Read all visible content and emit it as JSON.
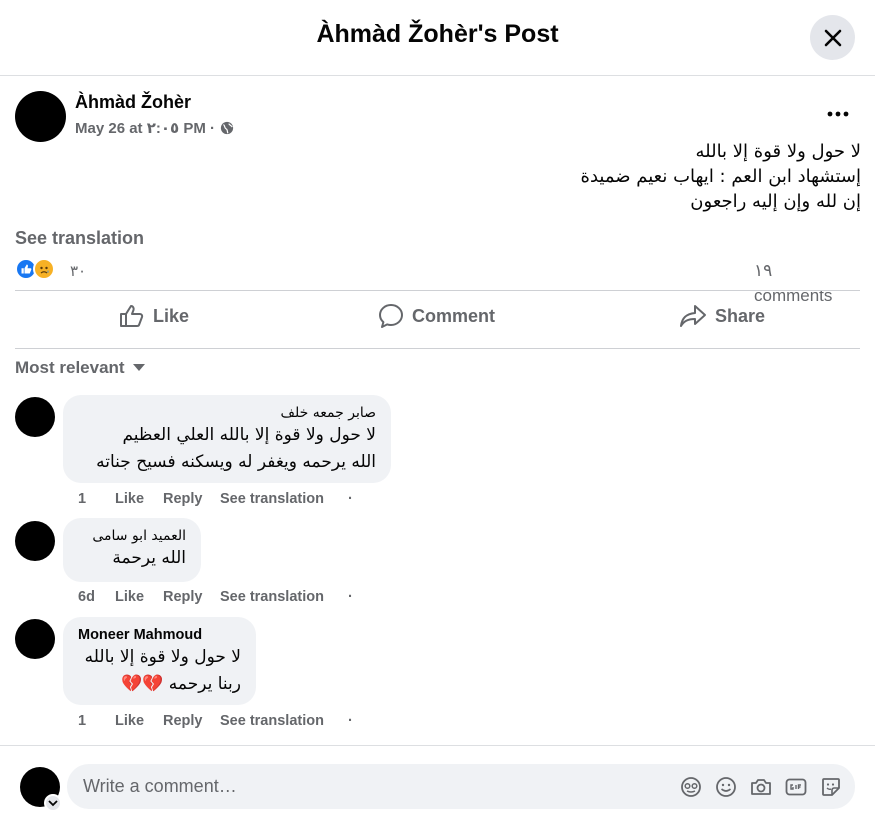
{
  "header": {
    "title": "Àhmàd Žohèr's Post"
  },
  "post": {
    "author": "Àhmàd Žohèr",
    "meta": "May 26 at ٢:٠٥ PM ·",
    "lines": [
      "لا حول ولا قوة إلا بالله",
      "إستشهاد ابن العم : ايهاب نعيم ضميدة",
      "إن لله وإن إليه راجعون"
    ],
    "see_translation": "See translation",
    "reaction_count": "٣٠",
    "comments_count": "١٩",
    "comments_word": "comments"
  },
  "actions": {
    "like": "Like",
    "comment": "Comment",
    "share": "Share"
  },
  "sort_label": "Most relevant",
  "comments": [
    {
      "name": "صابر جمعه خلف",
      "lines": [
        "لا حول ولا قوة إلا بالله العلي العظيم",
        "الله يرحمه ويغفر له ويسكنه فسيح جناته"
      ],
      "time": "1",
      "like": "Like",
      "reply": "Reply",
      "translate": "See translation"
    },
    {
      "name": "العميد ابو سامى",
      "lines": [
        "الله يرحمة"
      ],
      "time": "6d",
      "like": "Like",
      "reply": "Reply",
      "translate": "See translation"
    },
    {
      "name": "Moneer Mahmoud",
      "lines": [
        "لا حول ولا قوة إلا بالله",
        "ربنا يرحمه 💔💔"
      ],
      "time": "1",
      "like": "Like",
      "reply": "Reply",
      "translate": "See translation"
    }
  ],
  "composer": {
    "placeholder": "Write a comment…"
  },
  "colors": {
    "like_blue": "#1877f2",
    "sad_yellow": "#f7b125",
    "secondary_text": "#65676b",
    "bubble": "#f0f2f5"
  }
}
